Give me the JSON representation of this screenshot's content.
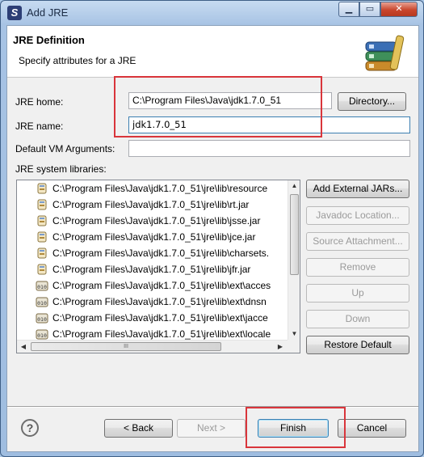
{
  "window": {
    "title": "Add JRE",
    "min_glyph": "▁",
    "max_glyph": "▭",
    "close_glyph": "✕"
  },
  "banner": {
    "title": "JRE Definition",
    "description": "Specify attributes for a JRE"
  },
  "form": {
    "jre_home_label": "JRE home:",
    "jre_home_value": "C:\\Program Files\\Java\\jdk1.7.0_51",
    "directory_button": "Directory...",
    "jre_name_label": "JRE name:",
    "jre_name_value": "jdk1.7.0_51",
    "vm_args_label": "Default VM Arguments:",
    "vm_args_value": "",
    "libraries_label": "JRE system libraries:"
  },
  "libraries": [
    "C:\\Program Files\\Java\\jdk1.7.0_51\\jre\\lib\\resource",
    "C:\\Program Files\\Java\\jdk1.7.0_51\\jre\\lib\\rt.jar",
    "C:\\Program Files\\Java\\jdk1.7.0_51\\jre\\lib\\jsse.jar",
    "C:\\Program Files\\Java\\jdk1.7.0_51\\jre\\lib\\jce.jar",
    "C:\\Program Files\\Java\\jdk1.7.0_51\\jre\\lib\\charsets.",
    "C:\\Program Files\\Java\\jdk1.7.0_51\\jre\\lib\\jfr.jar",
    "C:\\Program Files\\Java\\jdk1.7.0_51\\jre\\lib\\ext\\acces",
    "C:\\Program Files\\Java\\jdk1.7.0_51\\jre\\lib\\ext\\dnsn",
    "C:\\Program Files\\Java\\jdk1.7.0_51\\jre\\lib\\ext\\jacce",
    "C:\\Program Files\\Java\\jdk1.7.0_51\\jre\\lib\\ext\\locale"
  ],
  "library_icons": [
    "jar-icon",
    "jar-icon",
    "jar-icon",
    "jar-icon",
    "jar-icon",
    "jar-icon",
    "binary-jar-icon",
    "binary-jar-icon",
    "binary-jar-icon",
    "binary-jar-icon"
  ],
  "side_buttons": {
    "add_external_jars": "Add External JARs...",
    "javadoc_location": "Javadoc Location...",
    "source_attachment": "Source Attachment...",
    "remove": "Remove",
    "up": "Up",
    "down": "Down",
    "restore_default": "Restore Default"
  },
  "footer": {
    "help_glyph": "?",
    "back": "< Back",
    "next": "Next >",
    "finish": "Finish",
    "cancel": "Cancel"
  },
  "scrollbars": {
    "up_glyph": "▲",
    "down_glyph": "▼",
    "left_glyph": "◀",
    "right_glyph": "▶",
    "grip_glyph": "III"
  },
  "colors": {
    "highlight_box": "#d9353b",
    "default_button_border": "#3c7fb1"
  }
}
